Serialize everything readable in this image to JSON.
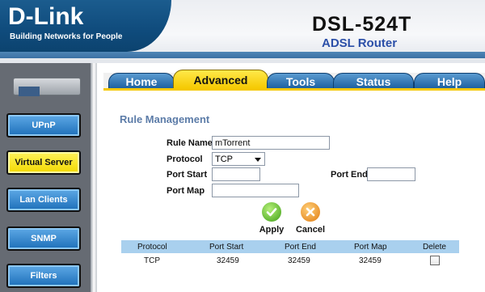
{
  "header": {
    "brand": "D-Link",
    "tagline": "Building Networks for People",
    "model": "DSL-524T",
    "subtitle": "ADSL Router"
  },
  "sidebar": {
    "items": [
      {
        "label": "UPnP",
        "active": false
      },
      {
        "label": "Virtual Server",
        "active": true
      },
      {
        "label": "Lan Clients",
        "active": false
      },
      {
        "label": "SNMP",
        "active": false
      },
      {
        "label": "Filters",
        "active": false
      }
    ]
  },
  "tabs": [
    {
      "label": "Home",
      "active": false
    },
    {
      "label": "Advanced",
      "active": true
    },
    {
      "label": "Tools",
      "active": false
    },
    {
      "label": "Status",
      "active": false
    },
    {
      "label": "Help",
      "active": false
    }
  ],
  "form": {
    "title": "Rule Management",
    "rule_name_label": "Rule Name",
    "rule_name_value": "mTorrent",
    "protocol_label": "Protocol",
    "protocol_value": "TCP",
    "port_start_label": "Port Start",
    "port_start_value": "",
    "port_end_label": "Port End",
    "port_end_value": "",
    "port_map_label": "Port Map",
    "port_map_value": "",
    "apply_label": "Apply",
    "cancel_label": "Cancel"
  },
  "table": {
    "headers": [
      "Protocol",
      "Port Start",
      "Port End",
      "Port Map",
      "Delete"
    ],
    "rows": [
      {
        "protocol": "TCP",
        "port_start": "32459",
        "port_end": "32459",
        "port_map": "32459",
        "delete": false
      }
    ]
  },
  "colors": {
    "brand_blue": "#0f4b7c",
    "tab_active": "#f5c800",
    "nav_blue": "#1d6fb9",
    "table_header": "#a9d0ee"
  }
}
